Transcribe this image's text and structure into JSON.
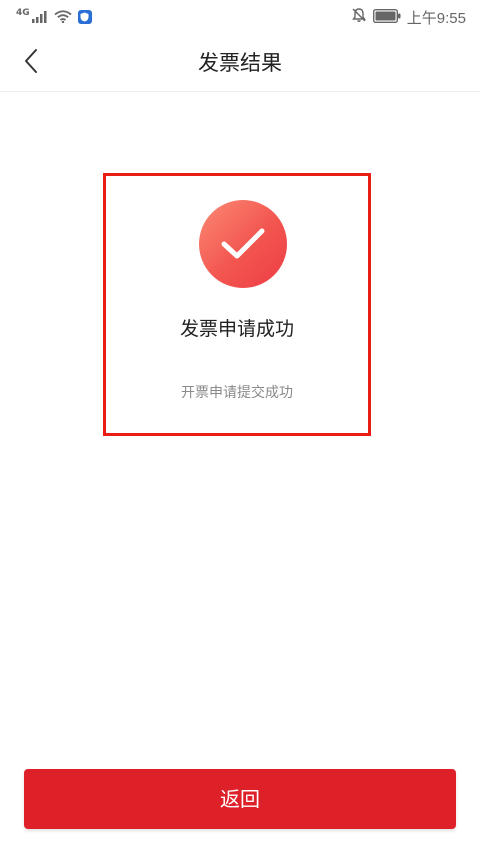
{
  "status_bar": {
    "network": "4G",
    "time": "上午9:55",
    "icons": [
      "signal-icon",
      "wifi-icon",
      "shield-app-icon",
      "mute-bell-icon",
      "battery-icon"
    ]
  },
  "header": {
    "title": "发票结果",
    "back_icon": "chevron-left-icon"
  },
  "result": {
    "icon": "check-circle-icon",
    "title": "发票申请成功",
    "description": "开票申请提交成功"
  },
  "footer": {
    "return_label": "返回"
  },
  "colors": {
    "accent": "#de2128",
    "highlight_border": "#ea1d12",
    "icon_gradient_start": "#fb8a74",
    "icon_gradient_end": "#ef3d46"
  }
}
